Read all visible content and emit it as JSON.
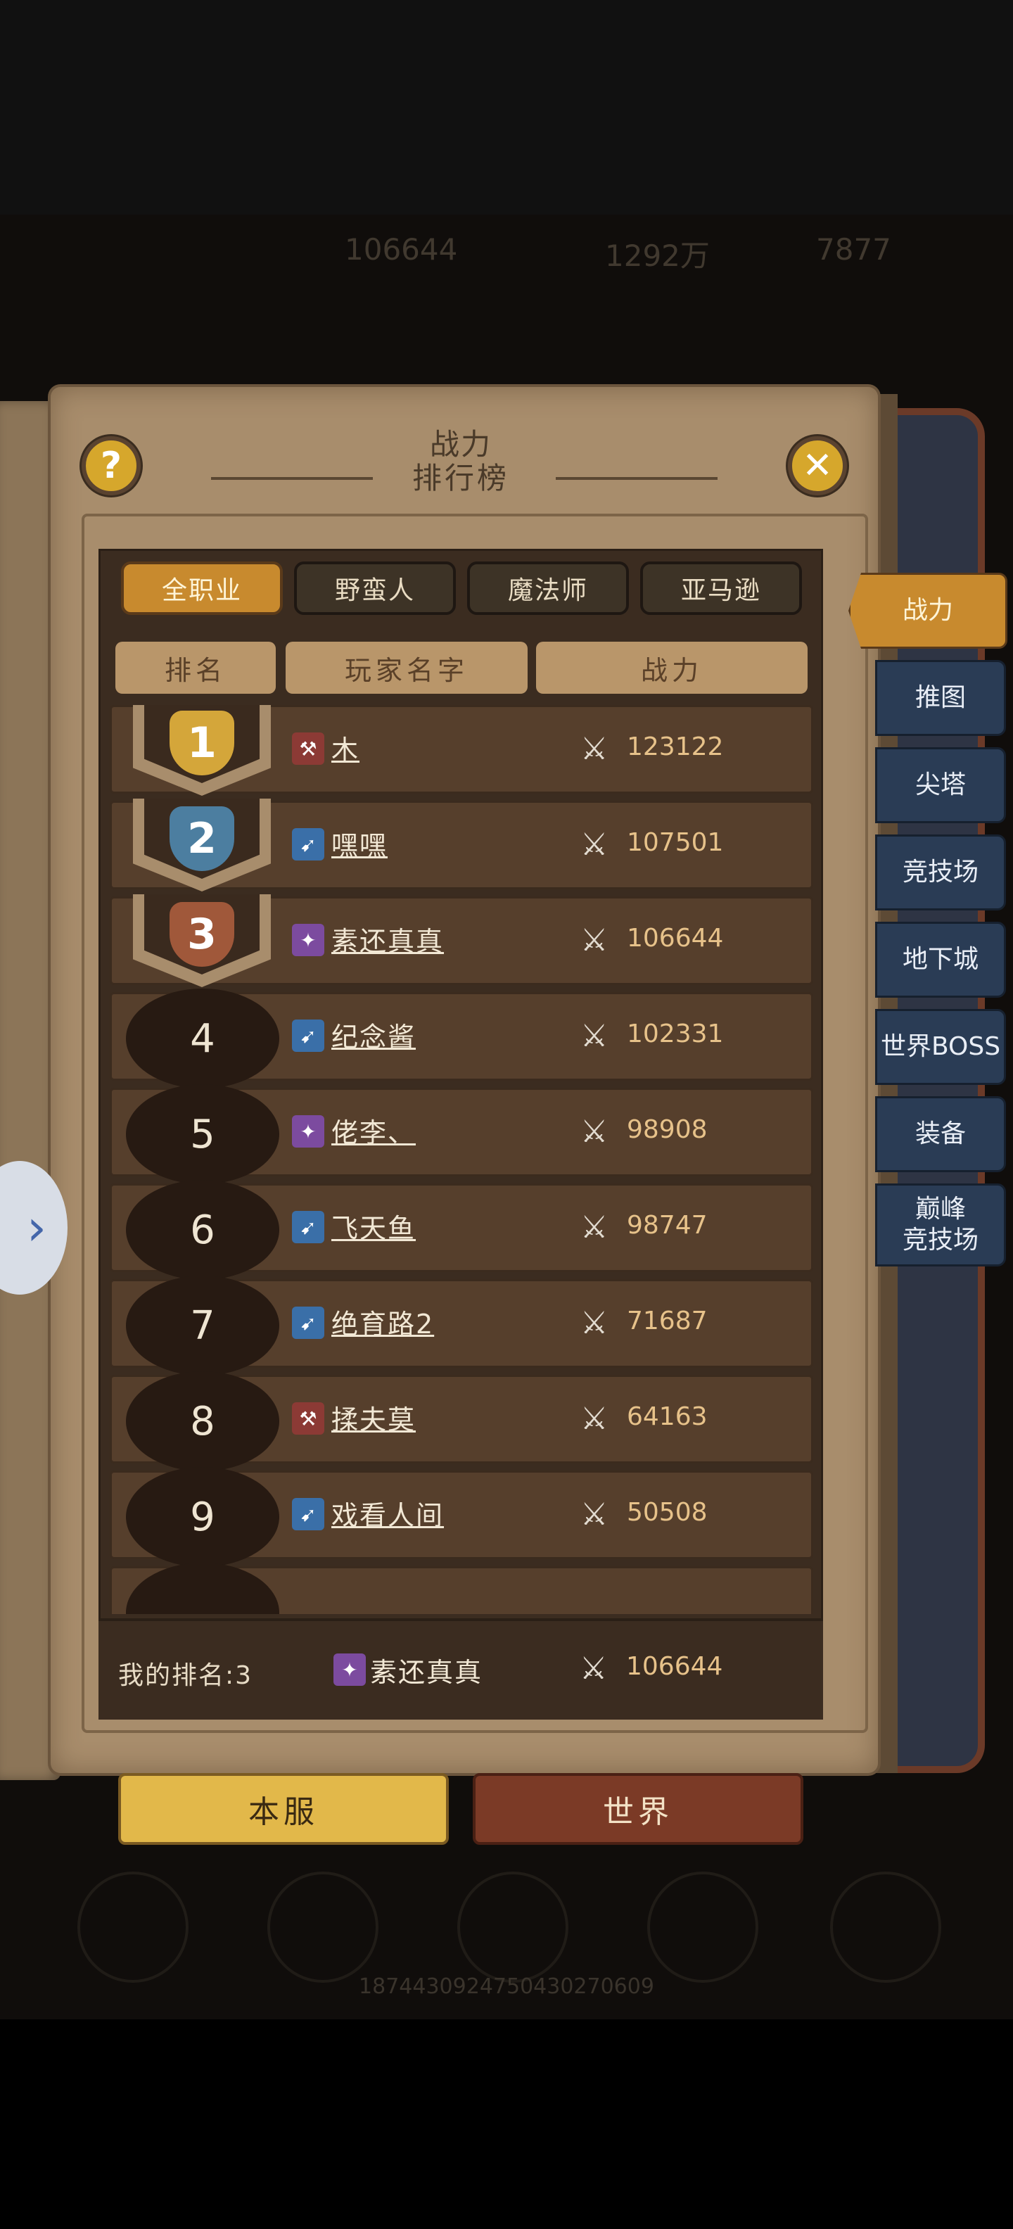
{
  "background": {
    "resources": [
      "106644",
      "1292万",
      "7877"
    ],
    "server_id": "1874430924750430270609"
  },
  "panel": {
    "title_top": "战力",
    "title_bottom": "排行榜",
    "help_icon_glyph": "?",
    "close_icon_glyph": "✕"
  },
  "filter_tabs": [
    {
      "label": "全职业",
      "active": true
    },
    {
      "label": "野蛮人",
      "active": false
    },
    {
      "label": "魔法师",
      "active": false
    },
    {
      "label": "亚马逊",
      "active": false
    }
  ],
  "columns": {
    "rank": "排名",
    "player": "玩家名字",
    "power": "战力"
  },
  "ranking": [
    {
      "rank": "1",
      "name": "木",
      "class": "barbarian",
      "power": "123122"
    },
    {
      "rank": "2",
      "name": "嘿嘿",
      "class": "amazon",
      "power": "107501"
    },
    {
      "rank": "3",
      "name": "素还真真",
      "class": "sorceress",
      "power": "106644"
    },
    {
      "rank": "4",
      "name": "纪念酱",
      "class": "amazon",
      "power": "102331"
    },
    {
      "rank": "5",
      "name": "佬李、",
      "class": "sorceress",
      "power": "98908"
    },
    {
      "rank": "6",
      "name": "飞天鱼",
      "class": "amazon",
      "power": "98747"
    },
    {
      "rank": "7",
      "name": "绝育路2",
      "class": "amazon",
      "power": "71687"
    },
    {
      "rank": "8",
      "name": "揉夫莫",
      "class": "barbarian",
      "power": "64163"
    },
    {
      "rank": "9",
      "name": "戏看人间",
      "class": "amazon",
      "power": "50508"
    }
  ],
  "my_rank": {
    "label": "我的排名:3",
    "name": "素还真真",
    "class": "sorceress",
    "power": "106644"
  },
  "side_tabs": [
    {
      "label": "战力",
      "active": true
    },
    {
      "label": "推图",
      "active": false
    },
    {
      "label": "尖塔",
      "active": false
    },
    {
      "label": "竞技场",
      "active": false
    },
    {
      "label": "地下城",
      "active": false
    },
    {
      "label": "世界BOSS",
      "active": false
    },
    {
      "label": "装备",
      "active": false
    },
    {
      "label": "巅峰\n竞技场",
      "active": false
    }
  ],
  "server_tabs": [
    {
      "label": "本服",
      "active": true
    },
    {
      "label": "世界",
      "active": false
    }
  ],
  "colors": {
    "accent_gold": "#c88a2e",
    "power_text": "#e7c28a",
    "class_barbarian": "#8c3a35",
    "class_amazon": "#3a6fa8",
    "class_sorceress": "#7c4b9f",
    "rank_gold": "#d4a63a",
    "rank_silver": "#4c7ea0",
    "rank_bronze": "#a0583a"
  }
}
